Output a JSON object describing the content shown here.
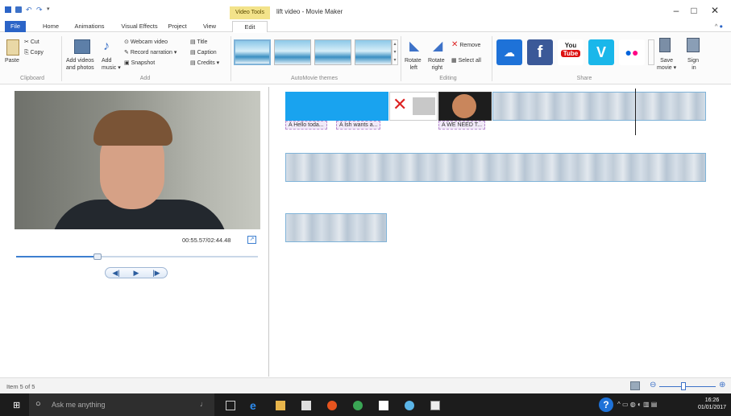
{
  "window": {
    "title": "lift video - Movie Maker",
    "context_tab": "Video Tools",
    "minimize": "–",
    "maximize": "□",
    "close": "✕"
  },
  "tabs": [
    "File",
    "Home",
    "Animations",
    "Visual Effects",
    "Project",
    "View",
    "Edit"
  ],
  "ribbon": {
    "clipboard": {
      "paste": "Paste",
      "cut": "Cut",
      "copy": "Copy",
      "label": "Clipboard"
    },
    "add": {
      "add_videos": "Add videos",
      "and_photos": "and photos",
      "add_music": "Add",
      "music": "music ▾",
      "webcam": "Webcam video",
      "narration": "Record narration ▾",
      "snapshot": "Snapshot",
      "title": "Title",
      "caption": "Caption",
      "credits": "Credits ▾",
      "label": "Add"
    },
    "themes": {
      "label": "AutoMovie themes"
    },
    "editing": {
      "rotate_left": "Rotate",
      "left": "left",
      "rotate_right": "Rotate",
      "right": "right",
      "remove": "Remove",
      "select_all": "Select all",
      "label": "Editing"
    },
    "share": {
      "save_movie": "Save",
      "movie": "movie ▾",
      "sign_in": "Sign",
      "in": "in",
      "label": "Share",
      "you": "You",
      "tube": "Tube"
    }
  },
  "preview": {
    "time": "00:55.57/02:44.48",
    "prev": "◀|",
    "play": "▶",
    "next": "|▶"
  },
  "captions": [
    "A Hello toda...",
    "A Ish wants a...",
    "A WE NEED T..."
  ],
  "status": {
    "item": "Item 5 of 5",
    "zoom_minus": "⊖",
    "zoom_plus": "⊕"
  },
  "taskbar": {
    "search": "Ask me anything",
    "time": "16:26",
    "date": "01/01/2017"
  },
  "colors": {
    "accent": "#2b64c7",
    "video_tools": "#f3e38a",
    "clip_border": "#7fb3d8",
    "taskbar": "#1c1c1c"
  }
}
